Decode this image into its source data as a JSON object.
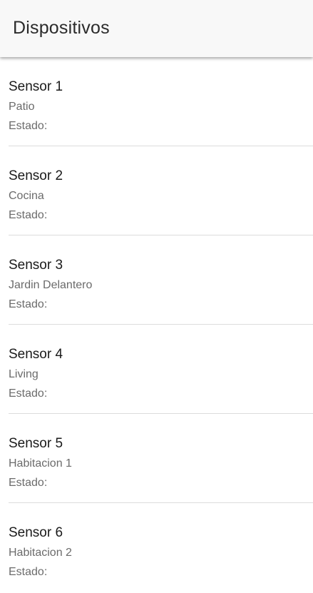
{
  "header": {
    "title": "Dispositivos"
  },
  "devices": [
    {
      "name": "Sensor 1",
      "location": "Patio",
      "status_label": "Estado:"
    },
    {
      "name": "Sensor 2",
      "location": "Cocina",
      "status_label": "Estado:"
    },
    {
      "name": "Sensor 3",
      "location": "Jardin Delantero",
      "status_label": "Estado:"
    },
    {
      "name": "Sensor 4",
      "location": "Living",
      "status_label": "Estado:"
    },
    {
      "name": "Sensor 5",
      "location": "Habitacion 1",
      "status_label": "Estado:"
    },
    {
      "name": "Sensor 6",
      "location": "Habitacion 2",
      "status_label": "Estado:"
    }
  ]
}
